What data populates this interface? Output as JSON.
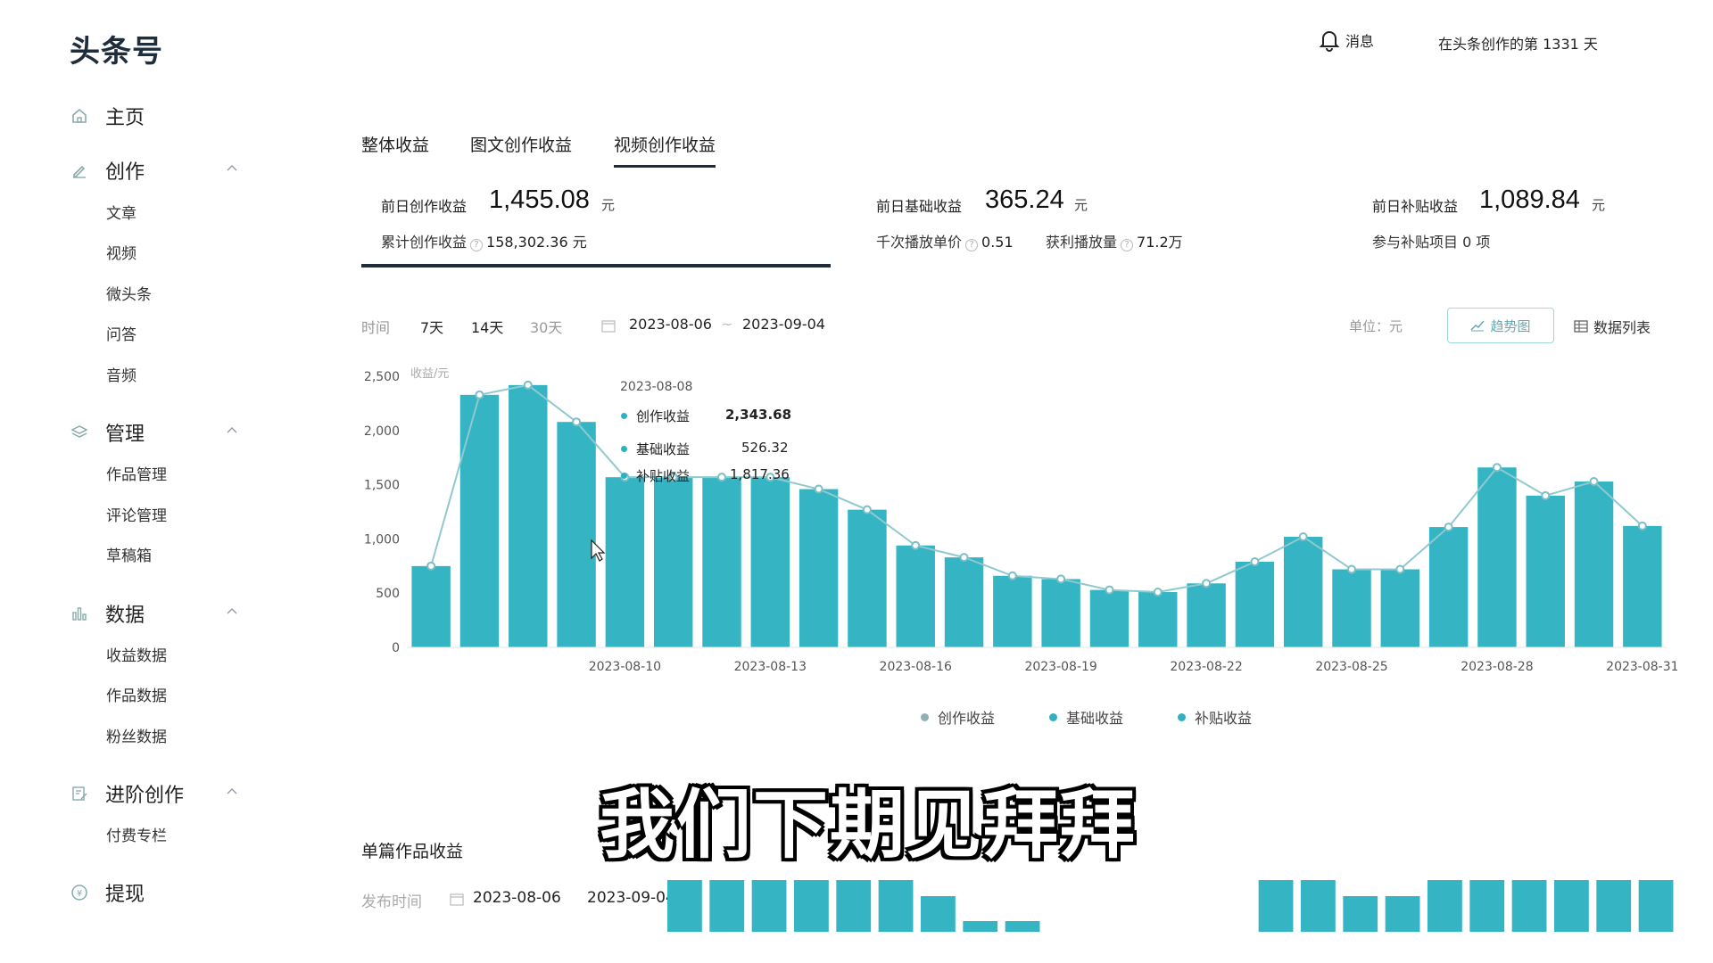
{
  "app": {
    "logo": "头条号",
    "notifications_label": "消息",
    "creator_days": "在头条创作的第 1331 天"
  },
  "sidebar": {
    "home": "主页",
    "create": {
      "label": "创作",
      "items": [
        "文章",
        "视频",
        "微头条",
        "问答",
        "音频"
      ]
    },
    "manage": {
      "label": "管理",
      "items": [
        "作品管理",
        "评论管理",
        "草稿箱"
      ]
    },
    "data": {
      "label": "数据",
      "items": [
        "收益数据",
        "作品数据",
        "粉丝数据"
      ]
    },
    "advanced": {
      "label": "进阶创作",
      "items": [
        "付费专栏"
      ]
    },
    "withdraw": "提现"
  },
  "tabs": [
    "整体收益",
    "图文创作收益",
    "视频创作收益"
  ],
  "active_tab": 2,
  "stats": {
    "prev_creation_label": "前日创作收益",
    "prev_creation_value": "1,455.08",
    "unit": "元",
    "total_creation_label": "累计创作收益",
    "total_creation_value": "158,302.36 元",
    "prev_basic_label": "前日基础收益",
    "prev_basic_value": "365.24",
    "cpm_label": "千次播放单价",
    "cpm_value": "0.51",
    "paid_plays_label": "获利播放量",
    "paid_plays_value": "71.2万",
    "prev_subsidy_label": "前日补贴收益",
    "prev_subsidy_value": "1,089.84",
    "subsidy_projects": "参与补贴项目 0 项"
  },
  "filters": {
    "time_label": "时间",
    "options": [
      "7天",
      "14天",
      "30天"
    ],
    "start_date": "2023-08-06",
    "range_sep": "~",
    "end_date": "2023-09-04",
    "unit_label": "单位：元",
    "trend_button": "趋势图",
    "list_button": "数据列表"
  },
  "tooltip": {
    "date": "2023-08-08",
    "rows": [
      {
        "label": "创作收益",
        "value": "2,343.68"
      },
      {
        "label": "基础收益",
        "value": "526.32"
      },
      {
        "label": "补贴收益",
        "value": "1,817.36"
      }
    ]
  },
  "legend": [
    "创作收益",
    "基础收益",
    "补贴收益"
  ],
  "colors": {
    "bar": "#35b5c4",
    "line": "#2a8f9b",
    "dark": "#1f2d3d"
  },
  "subtitle": "我们下期见拜拜",
  "single": {
    "title": "单篇作品收益",
    "date_label": "发布时间",
    "start_date": "2023-08-06",
    "end_date": "2023-09-04"
  },
  "chart_data": {
    "type": "bar",
    "y_unit_label": "收益/元",
    "yticks": [
      "0",
      "500",
      "1,000",
      "1,500",
      "2,000",
      "2,500"
    ],
    "ylim": [
      0,
      2600
    ],
    "xtick_labels": [
      "2023-08-10",
      "2023-08-13",
      "2023-08-16",
      "2023-08-19",
      "2023-08-22",
      "2023-08-25",
      "2023-08-28",
      "2023-08-31"
    ],
    "xtick_index": [
      4,
      7,
      10,
      13,
      16,
      19,
      22,
      25
    ],
    "series": [
      {
        "name": "创作收益",
        "values": [
          750,
          2330,
          2420,
          2080,
          1570,
          1570,
          1570,
          1570,
          1460,
          1270,
          940,
          830,
          660,
          630,
          530,
          510,
          590,
          790,
          1020,
          720,
          720,
          1110,
          1660,
          1400,
          1530,
          1120
        ]
      }
    ]
  }
}
